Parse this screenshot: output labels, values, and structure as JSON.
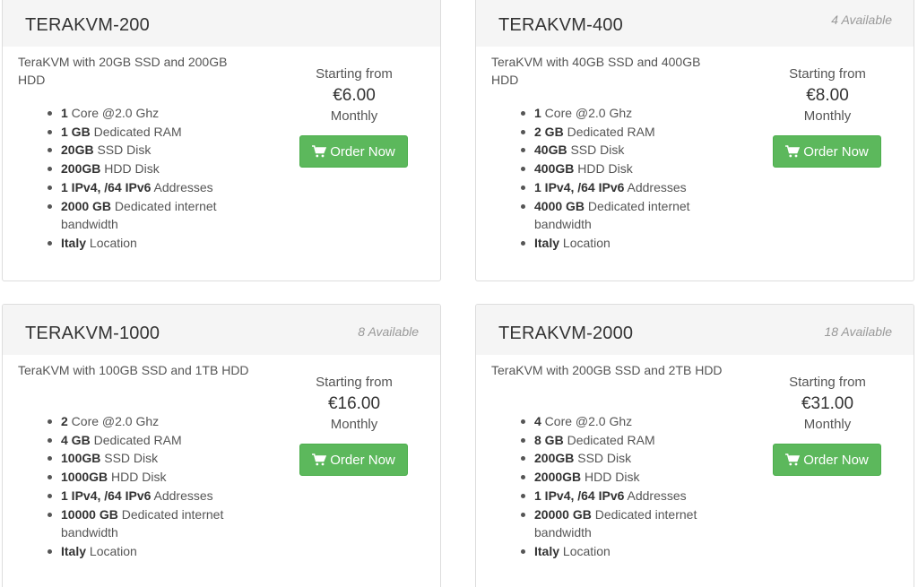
{
  "colors": {
    "header_bg": "#f5f5f5",
    "button_bg": "#5cb85c",
    "border": "#dddddd",
    "muted_text": "#999999"
  },
  "products": [
    {
      "name": "TERAKVM-200",
      "qty": "",
      "description": "TeraKVM with 20GB SSD and 200GB HDD",
      "features": [
        {
          "bold": "1",
          "text": " Core @2.0 Ghz"
        },
        {
          "bold": "1 GB",
          "text": " Dedicated RAM"
        },
        {
          "bold": "20GB",
          "text": " SSD Disk"
        },
        {
          "bold": "200GB",
          "text": " HDD Disk"
        },
        {
          "bold": "1 IPv4, /64 IPv6",
          "text": " Addresses"
        },
        {
          "bold": "2000 GB",
          "text": " Dedicated internet bandwidth"
        },
        {
          "bold": "Italy",
          "text": " Location"
        }
      ],
      "price_label": "Starting from",
      "price": "€6.00",
      "cycle": "Monthly",
      "button": "Order Now",
      "button_icon": "shopping-cart-icon"
    },
    {
      "name": "TERAKVM-400",
      "qty": "4 Available",
      "description": "TeraKVM with 40GB SSD and 400GB HDD",
      "features": [
        {
          "bold": "1",
          "text": " Core @2.0 Ghz"
        },
        {
          "bold": "2 GB",
          "text": " Dedicated RAM"
        },
        {
          "bold": "40GB",
          "text": " SSD Disk"
        },
        {
          "bold": "400GB",
          "text": " HDD Disk"
        },
        {
          "bold": "1 IPv4, /64 IPv6",
          "text": " Addresses"
        },
        {
          "bold": "4000 GB",
          "text": " Dedicated internet bandwidth"
        },
        {
          "bold": "Italy",
          "text": " Location"
        }
      ],
      "price_label": "Starting from",
      "price": "€8.00",
      "cycle": "Monthly",
      "button": "Order Now",
      "button_icon": "shopping-cart-icon"
    },
    {
      "name": "TERAKVM-1000",
      "qty": "8 Available",
      "description": "TeraKVM with 100GB SSD and 1TB HDD",
      "features": [
        {
          "bold": "2",
          "text": " Core @2.0 Ghz"
        },
        {
          "bold": "4 GB",
          "text": " Dedicated RAM"
        },
        {
          "bold": "100GB",
          "text": " SSD Disk"
        },
        {
          "bold": "1000GB",
          "text": " HDD Disk"
        },
        {
          "bold": "1 IPv4, /64 IPv6",
          "text": " Addresses"
        },
        {
          "bold": "10000 GB",
          "text": " Dedicated internet bandwidth"
        },
        {
          "bold": "Italy",
          "text": " Location"
        }
      ],
      "price_label": "Starting from",
      "price": "€16.00",
      "cycle": "Monthly",
      "button": "Order Now",
      "button_icon": "shopping-cart-icon"
    },
    {
      "name": "TERAKVM-2000",
      "qty": "18 Available",
      "description": "TeraKVM with 200GB SSD and 2TB HDD",
      "features": [
        {
          "bold": "4",
          "text": " Core @2.0 Ghz"
        },
        {
          "bold": "8 GB",
          "text": " Dedicated RAM"
        },
        {
          "bold": "200GB",
          "text": " SSD Disk"
        },
        {
          "bold": "2000GB",
          "text": " HDD Disk"
        },
        {
          "bold": "1 IPv4, /64 IPv6",
          "text": " Addresses"
        },
        {
          "bold": "20000 GB",
          "text": " Dedicated internet bandwidth"
        },
        {
          "bold": "Italy",
          "text": " Location"
        }
      ],
      "price_label": "Starting from",
      "price": "€31.00",
      "cycle": "Monthly",
      "button": "Order Now",
      "button_icon": "shopping-cart-icon"
    }
  ]
}
